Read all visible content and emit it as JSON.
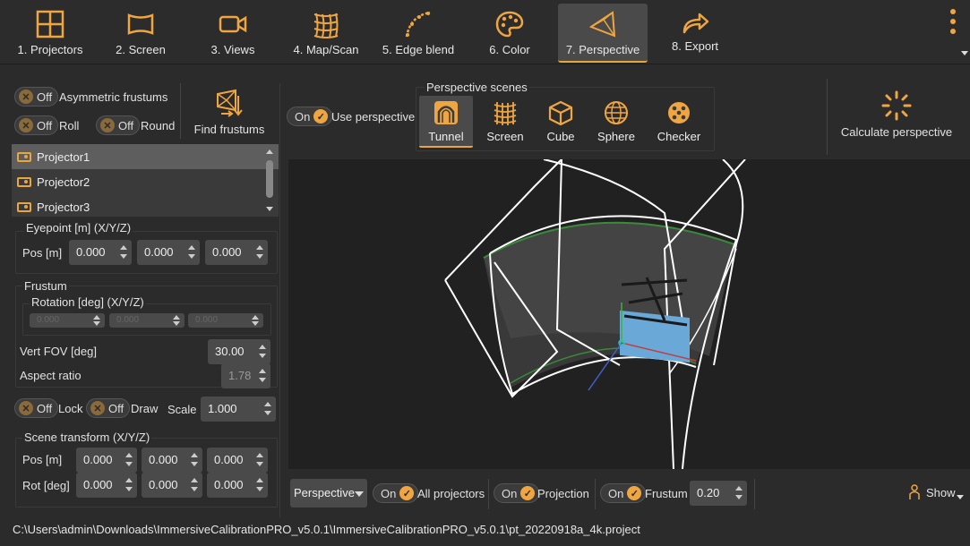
{
  "toolbar": {
    "tabs": [
      {
        "label": "1. Projectors",
        "icon": "projectors-grid-icon"
      },
      {
        "label": "2. Screen",
        "icon": "screen-icon"
      },
      {
        "label": "3. Views",
        "icon": "camera-icon"
      },
      {
        "label": "4. Map/Scan",
        "icon": "mesh-warp-icon"
      },
      {
        "label": "5. Edge blend",
        "icon": "edge-blend-curve-icon"
      },
      {
        "label": "6. Color",
        "icon": "palette-icon"
      },
      {
        "label": "7. Perspective",
        "icon": "perspective-frustum-icon"
      },
      {
        "label": "8. Export",
        "icon": "export-arrow-icon"
      }
    ],
    "active_tab": "7. Perspective"
  },
  "left_panel": {
    "asymmetric_frustums": {
      "state": "Off",
      "label": "Asymmetric frustums"
    },
    "roll": {
      "state": "Off",
      "label": "Roll"
    },
    "round": {
      "state": "Off",
      "label": "Round"
    },
    "find_frustums_label": "Find frustums",
    "projectors": [
      "Projector1",
      "Projector2",
      "Projector3"
    ],
    "selected_projector": "Projector1",
    "eyepoint": {
      "title": "Eyepoint [m] (X/Y/Z)",
      "pos_label": "Pos [m]",
      "pos": [
        "0.000",
        "0.000",
        "0.000"
      ]
    },
    "frustum": {
      "title": "Frustum",
      "rotation_title": "Rotation [deg] (X/Y/Z)",
      "rotation": [
        "0.000",
        "0.000",
        "0.000"
      ],
      "vert_fov_label": "Vert FOV [deg]",
      "vert_fov": "30.00",
      "aspect_label": "Aspect ratio",
      "aspect": "1.78"
    },
    "lock": {
      "state": "Off",
      "label": "Lock"
    },
    "draw": {
      "state": "Off",
      "label": "Draw"
    },
    "scale_label": "Scale",
    "scale": "1.000",
    "scene_transform": {
      "title": "Scene transform (X/Y/Z)",
      "pos_label": "Pos [m]",
      "pos": [
        "0.000",
        "0.000",
        "0.000"
      ],
      "rot_label": "Rot [deg]",
      "rot": [
        "0.000",
        "0.000",
        "0.000"
      ]
    }
  },
  "scene_bar": {
    "use_perspective": {
      "state": "On",
      "label": "Use perspective"
    },
    "scenes_title": "Perspective scenes",
    "scenes": [
      {
        "label": "Tunnel",
        "icon": "tunnel-icon"
      },
      {
        "label": "Screen",
        "icon": "grid-screen-icon"
      },
      {
        "label": "Cube",
        "icon": "cube-icon"
      },
      {
        "label": "Sphere",
        "icon": "sphere-icon"
      },
      {
        "label": "Checker",
        "icon": "checker-ball-icon"
      }
    ],
    "active_scene": "Tunnel",
    "calculate_label": "Calculate perspective"
  },
  "bottom_bar": {
    "view_mode": "Perspective",
    "all_projectors": {
      "state": "On",
      "label": "All projectors"
    },
    "projection": {
      "state": "On",
      "label": "Projection"
    },
    "frustum": {
      "state": "On",
      "label": "Frustum"
    },
    "frustum_value": "0.20",
    "show_label": "Show"
  },
  "status": {
    "path": "C:\\Users\\admin\\Downloads\\ImmersiveCalibrationPRO_v5.0.1\\ImmersiveCalibrationPRO_v5.0.1\\pt_20220918a_4k.project"
  },
  "colors": {
    "accent": "#e8a63c",
    "background": "#2b2b2b",
    "viewport": "#212121"
  }
}
